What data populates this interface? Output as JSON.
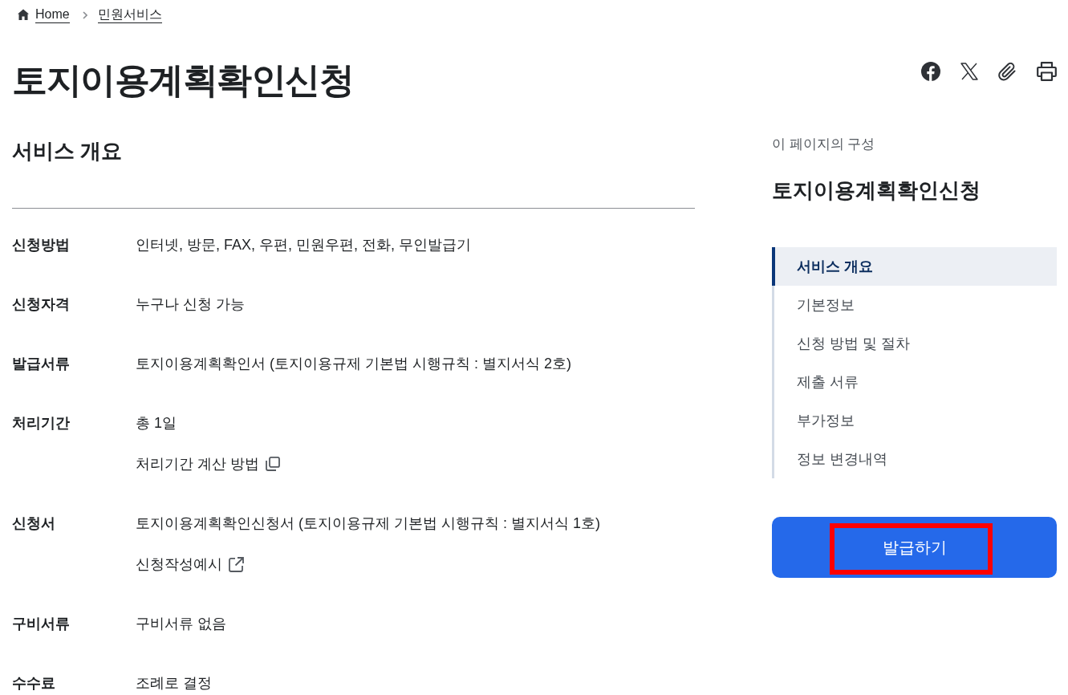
{
  "breadcrumb": [
    {
      "label": "Home",
      "kind": "home"
    },
    {
      "label": "민원서비스",
      "kind": "page"
    }
  ],
  "page_title": "토지이용계획확인신청",
  "overview": {
    "title": "서비스 개요",
    "rows": [
      {
        "label": "신청방법",
        "lines": [
          {
            "kind": "text",
            "text": "인터넷, 방문, FAX, 우편, 민원우편, 전화, 무인발급기"
          }
        ]
      },
      {
        "label": "신청자격",
        "lines": [
          {
            "kind": "text",
            "text": "누구나 신청 가능"
          }
        ]
      },
      {
        "label": "발급서류",
        "lines": [
          {
            "kind": "text",
            "text": "토지이용계획확인서 (토지이용규제 기본법 시행규칙 : 별지서식 2호)"
          }
        ]
      },
      {
        "label": "처리기간",
        "lines": [
          {
            "kind": "text",
            "text": "총 1일"
          },
          {
            "kind": "popup_link",
            "text": "처리기간 계산 방법"
          }
        ]
      },
      {
        "label": "신청서",
        "lines": [
          {
            "kind": "text",
            "text": "토지이용계획확인신청서 (토지이용규제 기본법 시행규칙 : 별지서식 1호)"
          },
          {
            "kind": "external_link",
            "text": "신청작성예시"
          }
        ]
      },
      {
        "label": "구비서류",
        "lines": [
          {
            "kind": "text",
            "text": "구비서류 없음"
          }
        ]
      },
      {
        "label": "수수료",
        "lines": [
          {
            "kind": "text",
            "text": "조례로 결정"
          }
        ]
      }
    ]
  },
  "toc": {
    "caption": "이 페이지의 구성",
    "title": "토지이용계획확인신청",
    "items": [
      {
        "label": "서비스 개요",
        "selected": true
      },
      {
        "label": "기본정보",
        "selected": false
      },
      {
        "label": "신청 방법 및 절차",
        "selected": false
      },
      {
        "label": "제출 서류",
        "selected": false
      },
      {
        "label": "부가정보",
        "selected": false
      },
      {
        "label": "정보 변경내역",
        "selected": false
      }
    ]
  },
  "issue_button": {
    "label": "발급하기",
    "highlighted": true
  }
}
